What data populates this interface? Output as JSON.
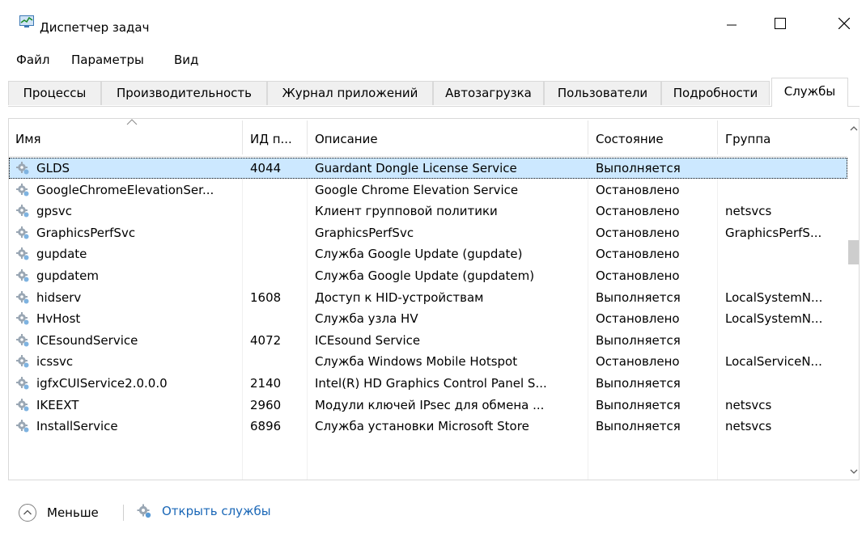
{
  "window": {
    "title": "Диспетчер задач"
  },
  "menu": [
    "Файл",
    "Параметры",
    "Вид"
  ],
  "tabs": [
    "Процессы",
    "Производительность",
    "Журнал приложений",
    "Автозагрузка",
    "Пользователи",
    "Подробности",
    "Службы"
  ],
  "active_tab": "Службы",
  "columns": {
    "name": "Имя",
    "pid": "ИД п...",
    "description": "Описание",
    "status": "Состояние",
    "group": "Группа"
  },
  "rows": [
    {
      "name": "GLDS",
      "pid": "4044",
      "description": "Guardant Dongle License Service",
      "status": "Выполняется",
      "group": ""
    },
    {
      "name": "GoogleChromeElevationSer...",
      "pid": "",
      "description": "Google Chrome Elevation Service",
      "status": "Остановлено",
      "group": ""
    },
    {
      "name": "gpsvc",
      "pid": "",
      "description": "Клиент групповой политики",
      "status": "Остановлено",
      "group": "netsvcs"
    },
    {
      "name": "GraphicsPerfSvc",
      "pid": "",
      "description": "GraphicsPerfSvc",
      "status": "Остановлено",
      "group": "GraphicsPerfS..."
    },
    {
      "name": "gupdate",
      "pid": "",
      "description": "Служба Google Update (gupdate)",
      "status": "Остановлено",
      "group": ""
    },
    {
      "name": "gupdatem",
      "pid": "",
      "description": "Служба Google Update (gupdatem)",
      "status": "Остановлено",
      "group": ""
    },
    {
      "name": "hidserv",
      "pid": "1608",
      "description": "Доступ к HID-устройствам",
      "status": "Выполняется",
      "group": "LocalSystemN..."
    },
    {
      "name": "HvHost",
      "pid": "",
      "description": "Служба узла HV",
      "status": "Остановлено",
      "group": "LocalSystemN..."
    },
    {
      "name": "ICEsoundService",
      "pid": "4072",
      "description": "ICEsound Service",
      "status": "Выполняется",
      "group": ""
    },
    {
      "name": "icssvc",
      "pid": "",
      "description": "Служба Windows Mobile Hotspot",
      "status": "Остановлено",
      "group": "LocalServiceN..."
    },
    {
      "name": "igfxCUIService2.0.0.0",
      "pid": "2140",
      "description": "Intel(R) HD Graphics Control Panel S...",
      "status": "Выполняется",
      "group": ""
    },
    {
      "name": "IKEEXT",
      "pid": "2960",
      "description": "Модули ключей IPsec для обмена ...",
      "status": "Выполняется",
      "group": "netsvcs"
    },
    {
      "name": "InstallService",
      "pid": "6896",
      "description": "Служба установки Microsoft Store",
      "status": "Выполняется",
      "group": "netsvcs"
    }
  ],
  "selected_row": "GLDS",
  "footer": {
    "less_label": "Меньше",
    "open_services_label": "Открыть службы"
  },
  "colors": {
    "selection": "#cce8ff",
    "link": "#1a67b7",
    "border": "#d9d9d9"
  },
  "icons": [
    "task-manager-icon",
    "minimize-icon",
    "maximize-icon",
    "close-icon",
    "service-gear-icon",
    "chevron-up-icon"
  ]
}
